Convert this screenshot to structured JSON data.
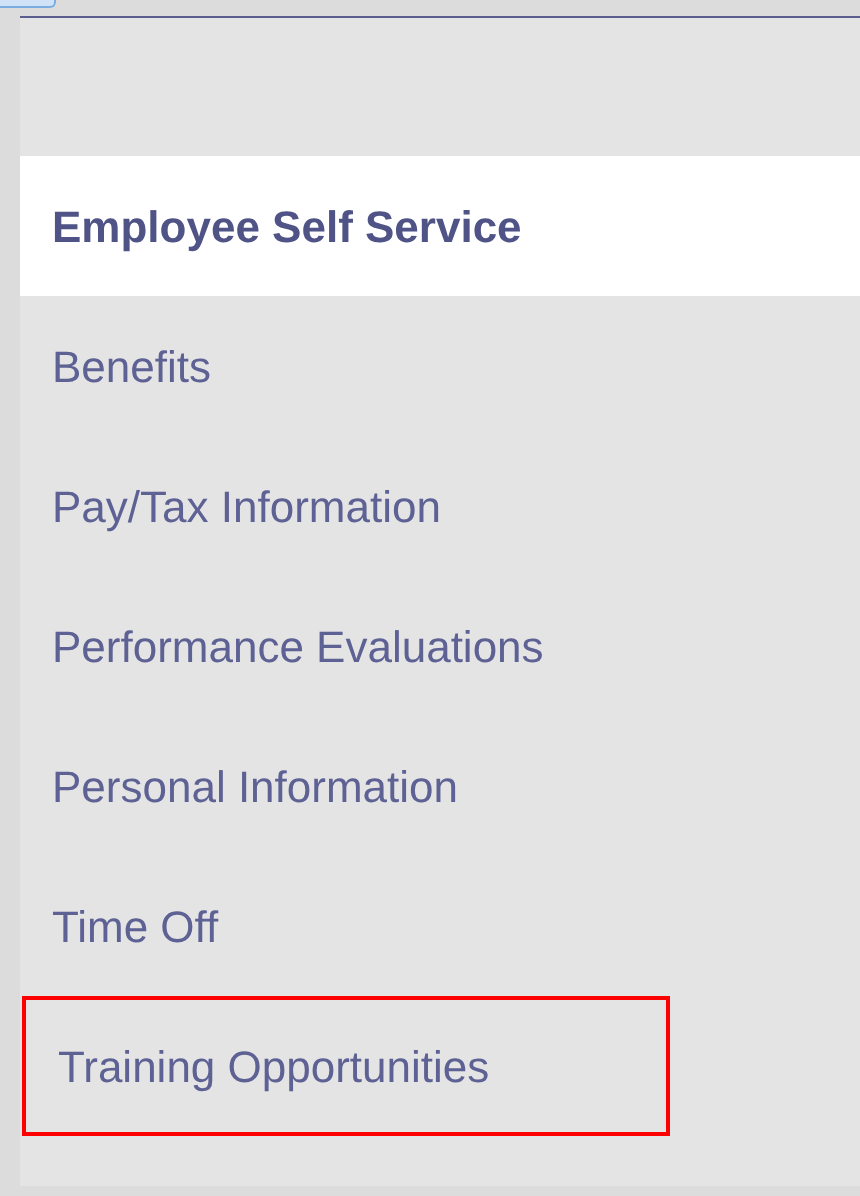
{
  "menu": {
    "items": [
      {
        "label": "Employee Self Service",
        "selected": true,
        "highlighted": false
      },
      {
        "label": "Benefits",
        "selected": false,
        "highlighted": false
      },
      {
        "label": "Pay/Tax Information",
        "selected": false,
        "highlighted": false
      },
      {
        "label": "Performance Evaluations",
        "selected": false,
        "highlighted": false
      },
      {
        "label": "Personal Information",
        "selected": false,
        "highlighted": false
      },
      {
        "label": "Time Off",
        "selected": false,
        "highlighted": false
      },
      {
        "label": "Training Opportunities",
        "selected": false,
        "highlighted": true
      }
    ]
  }
}
